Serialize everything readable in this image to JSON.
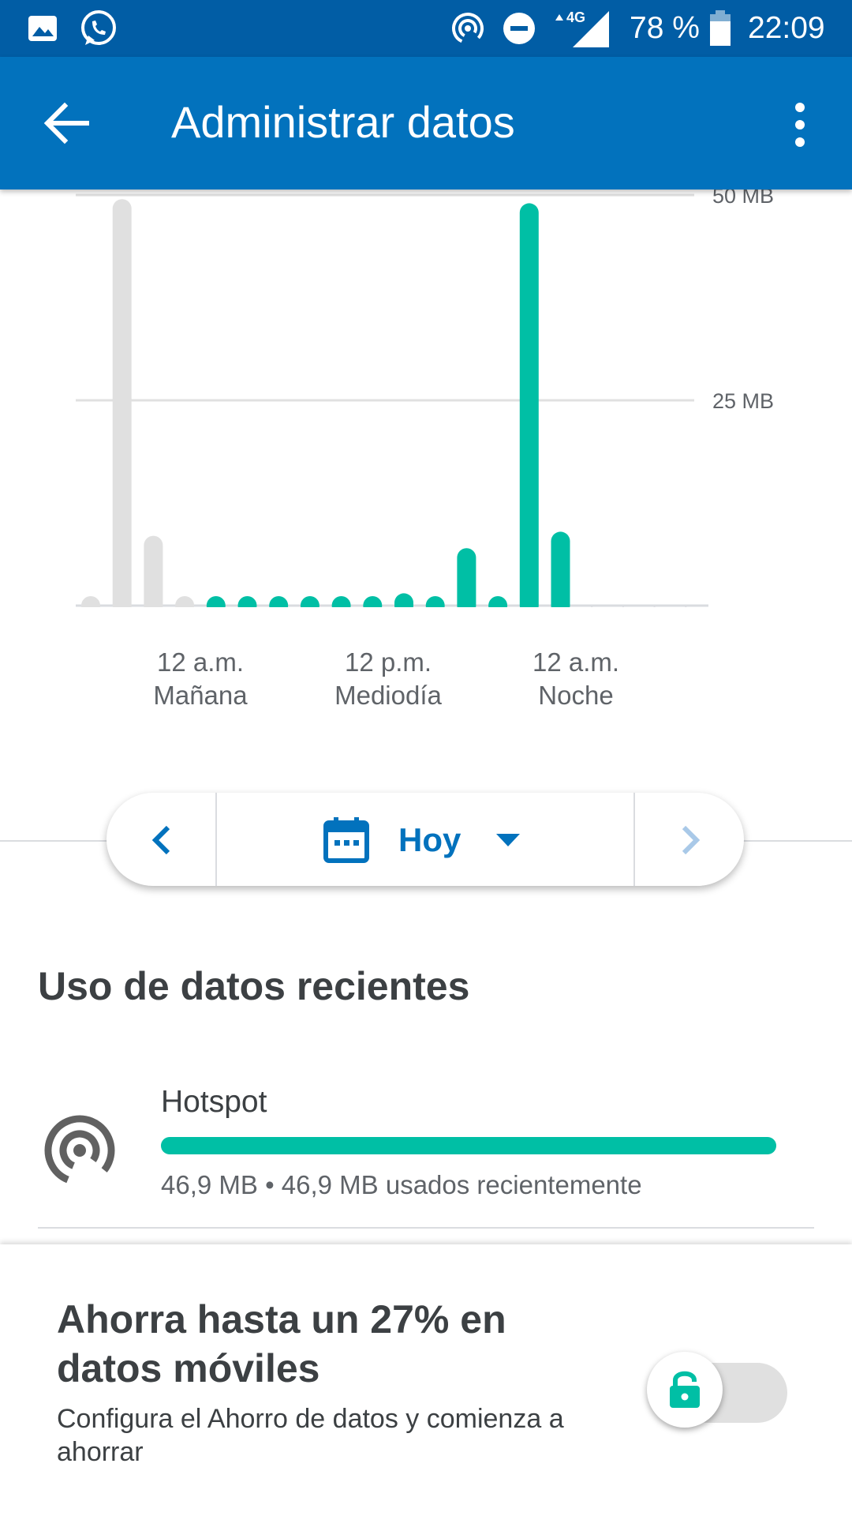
{
  "status_bar": {
    "battery": "78 %",
    "time": "22:09",
    "network": "4G",
    "icons": [
      "image-icon",
      "whatsapp-icon",
      "hotspot-icon",
      "do-not-disturb-icon",
      "signal-4g-icon",
      "battery-icon"
    ]
  },
  "app_bar": {
    "title": "Administrar datos",
    "back_icon": "arrow-back-icon",
    "menu_icon": "more-vert-icon"
  },
  "chart_data": {
    "type": "bar",
    "y_axis_labels": [
      "50 MB",
      "25 MB"
    ],
    "ylim": [
      0,
      50
    ],
    "x_tick_labels": [
      {
        "line1": "12 a.m.",
        "line2": "Mañana"
      },
      {
        "line1": "12 p.m.",
        "line2": "Mediodía"
      },
      {
        "line1": "12 a.m.",
        "line2": "Noche"
      }
    ],
    "bars": [
      {
        "value": 0.5,
        "today": false
      },
      {
        "value": 49.5,
        "today": false
      },
      {
        "value": 8.5,
        "today": false
      },
      {
        "value": 0.5,
        "today": false
      },
      {
        "value": 0.5,
        "today": true
      },
      {
        "value": 0.5,
        "today": true
      },
      {
        "value": 0.5,
        "today": true
      },
      {
        "value": 0.5,
        "today": true
      },
      {
        "value": 0.5,
        "today": true
      },
      {
        "value": 1.0,
        "today": true
      },
      {
        "value": 1.5,
        "today": true
      },
      {
        "value": 0.8,
        "today": true
      },
      {
        "value": 7.0,
        "today": true
      },
      {
        "value": 0.5,
        "today": true
      },
      {
        "value": 49.0,
        "today": true
      },
      {
        "value": 9.0,
        "today": true
      }
    ],
    "colors": {
      "past": "#e0e0e0",
      "today": "#00bfa5",
      "grid": "#e0e0e0"
    }
  },
  "date_selector": {
    "label": "Hoy",
    "calendar_icon": "calendar-icon",
    "prev_icon": "chevron-left-icon",
    "next_icon": "chevron-right-icon",
    "dropdown_icon": "dropdown-arrow-icon"
  },
  "recent": {
    "title": "Uso de datos recientes",
    "items": [
      {
        "name": "Hotspot",
        "icon": "hotspot-icon",
        "usage_text": "46,9 MB  •  46,9 MB usados recientemente",
        "bar_fraction": 1.0
      }
    ]
  },
  "saver": {
    "title": "Ahorra hasta un 27% en datos móviles",
    "description": "Configura el Ahorro de datos y comienza a ahorrar",
    "toggle_on": false,
    "lock_icon": "lock-icon"
  },
  "colors": {
    "status_bar": "#015da5",
    "app_bar": "#0272bd",
    "accent": "#00bfa5"
  }
}
